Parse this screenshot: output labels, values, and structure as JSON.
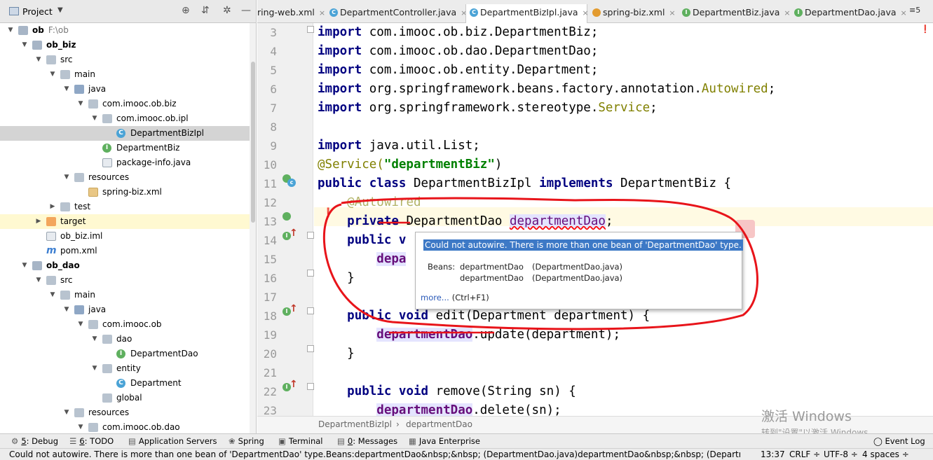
{
  "project_panel": {
    "title": "Project",
    "tree": [
      {
        "label": "ob",
        "path": "F:\\ob",
        "bold": true,
        "expanded": true,
        "icon": "module-folder-icon",
        "level": 0
      },
      {
        "label": "ob_biz",
        "bold": true,
        "expanded": true,
        "icon": "module-folder-icon",
        "level": 1
      },
      {
        "label": "src",
        "expanded": true,
        "icon": "folder-icon",
        "level": 2
      },
      {
        "label": "main",
        "expanded": true,
        "icon": "folder-icon",
        "level": 3
      },
      {
        "label": "java",
        "expanded": true,
        "icon": "source-folder-icon",
        "level": 4
      },
      {
        "label": "com.imooc.ob.biz",
        "expanded": true,
        "icon": "package-icon",
        "level": 5
      },
      {
        "label": "com.imooc.ob.ipl",
        "expanded": true,
        "icon": "package-icon",
        "level": 6
      },
      {
        "label": "DepartmentBizIpl",
        "icon": "class-icon",
        "level": 7,
        "selected": true
      },
      {
        "label": "DepartmentBiz",
        "icon": "interface-icon",
        "level": 6
      },
      {
        "label": "package-info.java",
        "icon": "java-file-icon",
        "level": 6
      },
      {
        "label": "resources",
        "expanded": true,
        "icon": "resources-folder-icon",
        "level": 4
      },
      {
        "label": "spring-biz.xml",
        "icon": "xml-file-icon",
        "level": 5
      },
      {
        "label": "test",
        "collapsed": true,
        "icon": "folder-icon",
        "level": 3
      },
      {
        "label": "target",
        "collapsed": true,
        "icon": "excluded-folder-icon",
        "level": 2,
        "highlight": true
      },
      {
        "label": "ob_biz.iml",
        "icon": "iml-file-icon",
        "level": 2
      },
      {
        "label": "pom.xml",
        "icon": "maven-icon",
        "level": 2
      },
      {
        "label": "ob_dao",
        "bold": true,
        "expanded": true,
        "icon": "module-folder-icon",
        "level": 1
      },
      {
        "label": "src",
        "expanded": true,
        "icon": "folder-icon",
        "level": 2
      },
      {
        "label": "main",
        "expanded": true,
        "icon": "folder-icon",
        "level": 3
      },
      {
        "label": "java",
        "expanded": true,
        "icon": "source-folder-icon",
        "level": 4
      },
      {
        "label": "com.imooc.ob",
        "expanded": true,
        "icon": "package-icon",
        "level": 5
      },
      {
        "label": "dao",
        "expanded": true,
        "icon": "package-icon",
        "level": 6
      },
      {
        "label": "DepartmentDao",
        "icon": "interface-icon",
        "level": 7
      },
      {
        "label": "entity",
        "expanded": true,
        "icon": "package-icon",
        "level": 6
      },
      {
        "label": "Department",
        "icon": "class-icon",
        "level": 7
      },
      {
        "label": "global",
        "icon": "package-icon",
        "level": 6
      },
      {
        "label": "resources",
        "expanded": true,
        "icon": "resources-folder-icon",
        "level": 4
      },
      {
        "label": "com.imooc.ob.dao",
        "expanded": true,
        "icon": "package-icon",
        "level": 5
      }
    ]
  },
  "tabs": [
    {
      "label": "ring-web.xml",
      "icon": "none"
    },
    {
      "label": "DepartmentController.java",
      "icon": "class"
    },
    {
      "label": "DepartmentBizIpl.java",
      "icon": "class",
      "active": true
    },
    {
      "label": "spring-biz.xml",
      "icon": "xml"
    },
    {
      "label": "DepartmentBiz.java",
      "icon": "interface"
    },
    {
      "label": "DepartmentDao.java",
      "icon": "interface"
    }
  ],
  "tab_overflow": "≡5",
  "tab_close": "×",
  "editor": {
    "lines": [
      {
        "n": "3",
        "html_kind": "import",
        "text": "com.imooc.ob.biz.DepartmentBiz;"
      },
      {
        "n": "4",
        "html_kind": "import",
        "text": "com.imooc.ob.dao.DepartmentDao;"
      },
      {
        "n": "5",
        "html_kind": "import",
        "text": "com.imooc.ob.entity.Department;"
      },
      {
        "n": "6",
        "html_kind": "import_annot",
        "text": "org.springframework.beans.factory.annotation.",
        "tail": "Autowired",
        "end": ";"
      },
      {
        "n": "7",
        "html_kind": "import_annot",
        "text": "org.springframework.stereotype.",
        "tail": "Service",
        "end": ";"
      },
      {
        "n": "8",
        "html_kind": "blank"
      },
      {
        "n": "9",
        "html_kind": "import",
        "text": "java.util.List;"
      },
      {
        "n": "10",
        "html_kind": "service",
        "annot": "@Service(",
        "str": "\"departmentBiz\"",
        "end": ")"
      },
      {
        "n": "11",
        "html_kind": "classdecl"
      },
      {
        "n": "12",
        "html_kind": "autowired",
        "text": "@Autowired"
      },
      {
        "n": "13",
        "html_kind": "field"
      },
      {
        "n": "14",
        "html_kind": "pubv"
      },
      {
        "n": "15",
        "html_kind": "depa"
      },
      {
        "n": "16",
        "html_kind": "close"
      },
      {
        "n": "17",
        "html_kind": "blank"
      },
      {
        "n": "18",
        "html_kind": "edit"
      },
      {
        "n": "19",
        "html_kind": "update"
      },
      {
        "n": "20",
        "html_kind": "close"
      },
      {
        "n": "21",
        "html_kind": "blank"
      },
      {
        "n": "22",
        "html_kind": "remove"
      },
      {
        "n": "23",
        "html_kind": "delete"
      }
    ],
    "kw": {
      "import": "import",
      "public": "public",
      "class": "class",
      "implements": "implements",
      "private": "private",
      "void": "void"
    },
    "class_name": "DepartmentBizIpl",
    "iface_name": "DepartmentBiz",
    "field_type": "DepartmentDao",
    "field_name": "departmentDao",
    "line14_tail": "public v",
    "line15_tail": "depa",
    "edit_sig": "edit(Department department) {",
    "update_call": ".update(department);",
    "remove_sig": "remove(String sn) {",
    "delete_call": ".delete(sn);",
    "close_brace": "}",
    "open_brace": "{",
    "semicolon": ";"
  },
  "popup": {
    "message": "Could not autowire. There is more than one bean of 'DepartmentDao' type.",
    "beans_label": "Beans:",
    "beans": [
      {
        "name": "departmentDao",
        "file": "(DepartmentDao.java)"
      },
      {
        "name": "departmentDao",
        "file": "(DepartmentDao.java)"
      }
    ],
    "more_link": "more...",
    "shortcut": "(Ctrl+F1)"
  },
  "breadcrumb": [
    "DepartmentBizIpl",
    "›",
    "departmentDao"
  ],
  "toolbar": [
    {
      "icon": "debug-icon",
      "key": "5",
      "label": ": Debug"
    },
    {
      "icon": "todo-icon",
      "key": "6",
      "label": ": TODO"
    },
    {
      "icon": "app-servers-icon",
      "label": "Application Servers"
    },
    {
      "icon": "spring-icon",
      "label": "Spring"
    },
    {
      "icon": "terminal-icon",
      "label": "Terminal"
    },
    {
      "icon": "messages-icon",
      "key": "0",
      "label": ": Messages"
    },
    {
      "icon": "java-enterprise-icon",
      "label": "Java Enterprise"
    }
  ],
  "event_log": "Event Log",
  "status": {
    "message": "Could not autowire. There is more than one bean of 'DepartmentDao' type.Beans:departmentDao&nbsp;&nbsp; (DepartmentDao.java)departmentDao&nbsp;&nbsp; (Department...",
    "position": "13:37",
    "line_sep": "CRLF ÷",
    "encoding": "UTF-8 ÷",
    "indent": "4 spaces ÷"
  },
  "watermark": {
    "line1": "激活 Windows",
    "line2": "转到\"设置\"以激活 Windows。"
  },
  "colors": {
    "selection": "#3d79c6",
    "annotation": "#808000",
    "keyword": "#000080",
    "string": "#008000",
    "field": "#660e7a",
    "circle": "#e8141a"
  }
}
